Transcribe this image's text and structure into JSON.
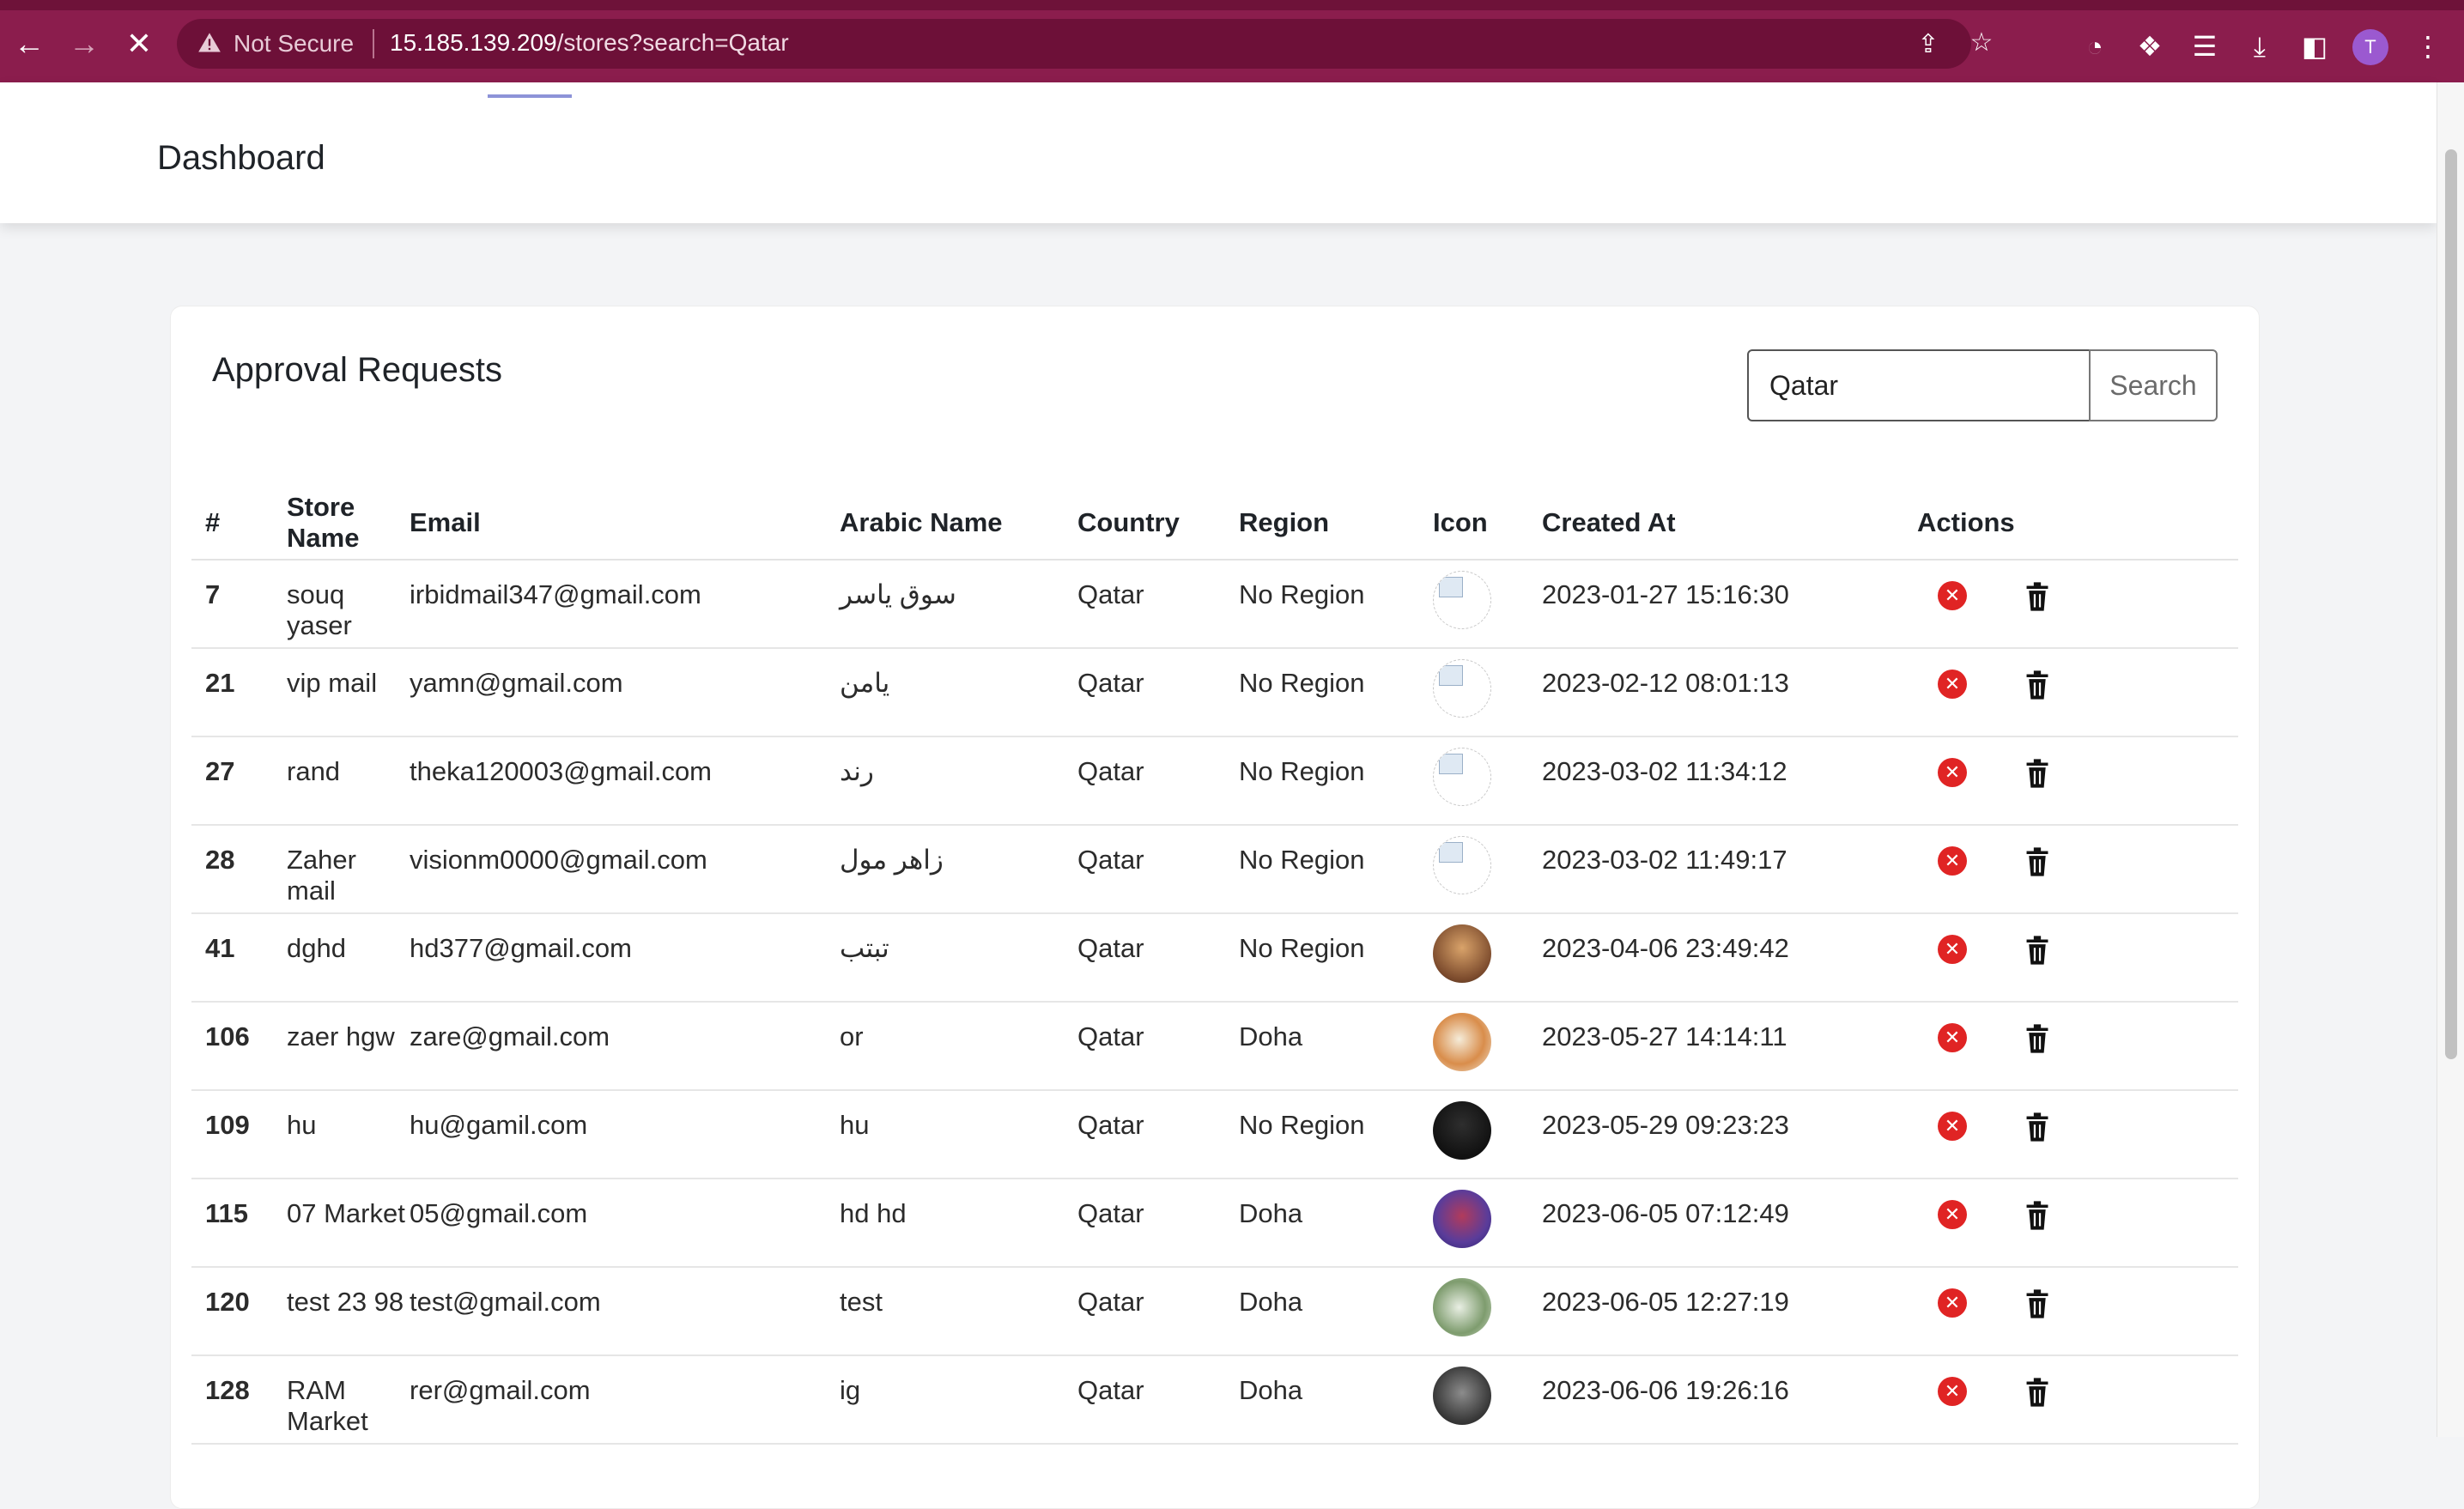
{
  "browser": {
    "security_label": "Not Secure",
    "url_host": "15.185.139.209",
    "url_path": "/stores?search=Qatar",
    "profile_initial": "T"
  },
  "header": {
    "title": "Dashboard"
  },
  "card": {
    "title": "Approval Requests",
    "search_value": "Qatar",
    "search_button_label": "Search"
  },
  "table": {
    "columns": [
      "#",
      "Store Name",
      "Email",
      "Arabic Name",
      "Country",
      "Region",
      "Icon",
      "Created At",
      "Actions"
    ],
    "rows": [
      {
        "id": "7",
        "store_name": "souq yaser",
        "email": "irbidmail347@gmail.com",
        "arabic_name": "سوق ياسر",
        "country": "Qatar",
        "region": "No Region",
        "created_at": "2023-01-27 15:16:30"
      },
      {
        "id": "21",
        "store_name": "vip mail",
        "email": "yamn@gmail.com",
        "arabic_name": "يامن",
        "country": "Qatar",
        "region": "No Region",
        "created_at": "2023-02-12 08:01:13"
      },
      {
        "id": "27",
        "store_name": "rand",
        "email": "theka120003@gmail.com",
        "arabic_name": "رند",
        "country": "Qatar",
        "region": "No Region",
        "created_at": "2023-03-02 11:34:12"
      },
      {
        "id": "28",
        "store_name": "Zaher mail",
        "email": "visionm0000@gmail.com",
        "arabic_name": "زاهر مول",
        "country": "Qatar",
        "region": "No Region",
        "created_at": "2023-03-02 11:49:17"
      },
      {
        "id": "41",
        "store_name": "dghd",
        "email": "hd377@gmail.com",
        "arabic_name": "تبتب",
        "country": "Qatar",
        "region": "No Region",
        "created_at": "2023-04-06 23:49:42"
      },
      {
        "id": "106",
        "store_name": "zaer hgw",
        "email": "zare@gmail.com",
        "arabic_name": "or",
        "country": "Qatar",
        "region": "Doha",
        "created_at": "2023-05-27 14:14:11"
      },
      {
        "id": "109",
        "store_name": "hu",
        "email": "hu@gamil.com",
        "arabic_name": "hu",
        "country": "Qatar",
        "region": "No Region",
        "created_at": "2023-05-29 09:23:23"
      },
      {
        "id": "115",
        "store_name": "07 Market",
        "email": "05@gmail.com",
        "arabic_name": "hd hd",
        "country": "Qatar",
        "region": "Doha",
        "created_at": "2023-06-05 07:12:49"
      },
      {
        "id": "120",
        "store_name": "test 23 98",
        "email": "test@gmail.com",
        "arabic_name": "test",
        "country": "Qatar",
        "region": "Doha",
        "created_at": "2023-06-05 12:27:19"
      },
      {
        "id": "128",
        "store_name": "RAM Market",
        "email": "rer@gmail.com",
        "arabic_name": "ig",
        "country": "Qatar",
        "region": "Doha",
        "created_at": "2023-06-06 19:26:16"
      }
    ]
  }
}
